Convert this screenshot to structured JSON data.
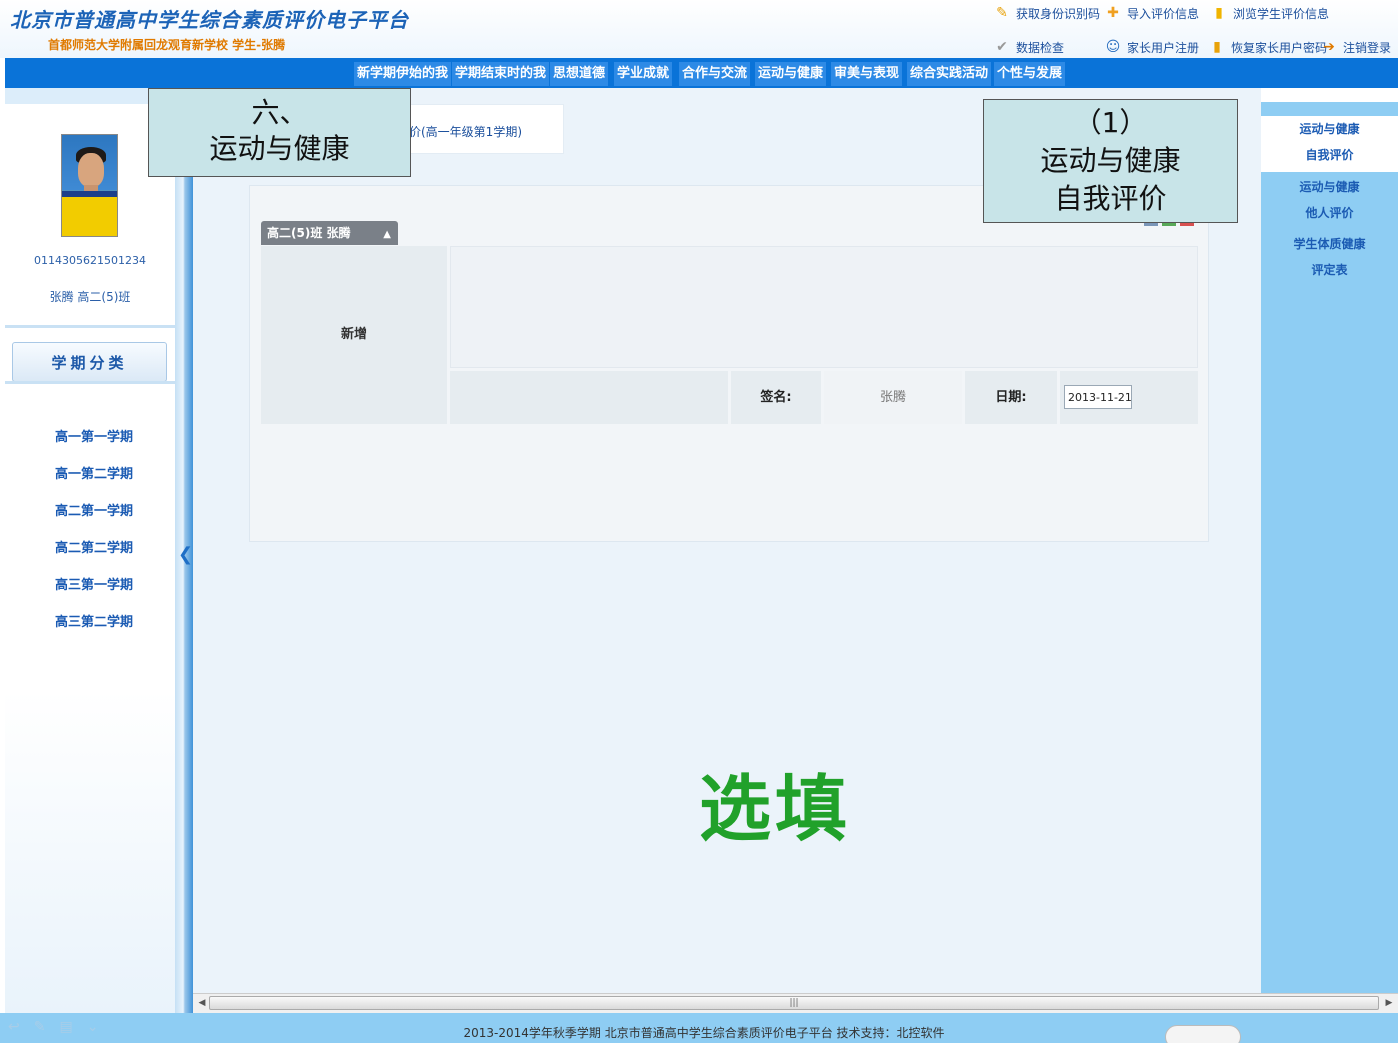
{
  "header": {
    "title": "北京市普通高中学生综合素质评价电子平台",
    "subtitle": "首都师范大学附属回龙观育新学校 学生-张腾",
    "links": [
      {
        "label": "获取身份识别码",
        "icon": "pen-icon"
      },
      {
        "label": "导入评价信息",
        "icon": "import-icon"
      },
      {
        "label": "浏览学生评价信息",
        "icon": "book-icon"
      },
      {
        "label": "数据检查",
        "icon": "check-icon"
      },
      {
        "label": "家长用户注册",
        "icon": "user-icon"
      },
      {
        "label": "恢复家长用户密码",
        "icon": "key-icon"
      },
      {
        "label": "注销登录",
        "icon": "logout-icon"
      }
    ]
  },
  "nav": {
    "items": [
      "新学期伊始的我",
      "学期结束时的我",
      "思想道德",
      "学业成就",
      "合作与交流",
      "运动与健康",
      "审美与表现",
      "综合实践活动",
      "个性与发展"
    ]
  },
  "profile": {
    "student_id": "0114305621501234",
    "name_class": "张腾 高二(5)班"
  },
  "semesters": {
    "header": "学期分类",
    "items": [
      "高一第一学期",
      "高一第二学期",
      "高二第一学期",
      "高二第二学期",
      "高三第一学期",
      "高三第二学期"
    ]
  },
  "main": {
    "tab_label": "价(高一年级第1学期)",
    "card_title": "高二(5)班 张腾",
    "row_label": "新增",
    "signature_label": "签名:",
    "signature_value": "张腾",
    "date_label": "日期:",
    "date_value": "2013-11-21",
    "optional_text": "选填"
  },
  "right_menu": {
    "items": [
      {
        "line1": "运动与健康",
        "line2": "自我评价"
      },
      {
        "line1": "运动与健康",
        "line2": "他人评价"
      },
      {
        "line1": "学生体质健康",
        "line2": "评定表"
      }
    ]
  },
  "callouts": {
    "left_line1": "六、",
    "left_line2": "运动与健康",
    "right_line1": "（1）",
    "right_line2": "运动与健康",
    "right_line3": "自我评价"
  },
  "footer": {
    "text": "2013-2014学年秋季学期 北京市普通高中学生综合素质评价电子平台 技术支持：北控软件"
  },
  "colors": {
    "nav_bg": "#0a73d8",
    "accent_blue": "#1c63b7",
    "optional_green": "#21a12a",
    "right_panel": "#8ecdf3"
  }
}
